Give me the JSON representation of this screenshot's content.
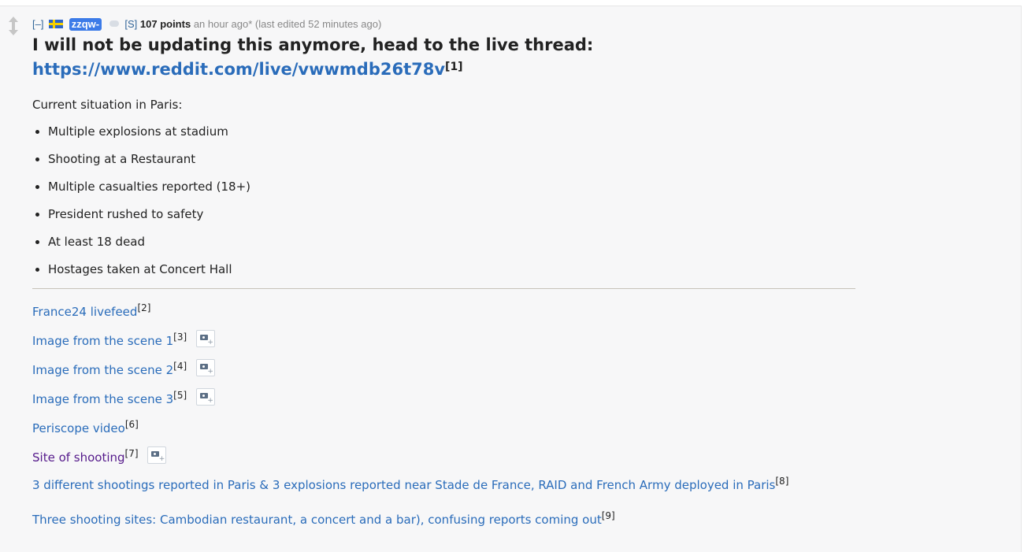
{
  "comment": {
    "expand_toggle": "[–]",
    "author": "zzqw-",
    "submitter_tag": "[S]",
    "score": "107 points",
    "time": "an hour ago*",
    "edited": "(last edited 52 minutes ago)",
    "headline": "I will not be updating this anymore, head to the live thread:",
    "live_link": "https://www.reddit.com/live/vwwmdb26t78v",
    "live_link_ref": "[1]",
    "intro": "Current situation in Paris:",
    "bullets": [
      "Multiple explosions at stadium",
      "Shooting at a Restaurant",
      "Multiple casualties reported (18+)",
      "President rushed to safety",
      "At least 18 dead",
      "Hostages taken at Concert Hall"
    ],
    "links": [
      {
        "text": "France24 livefeed",
        "ref": "[2]"
      },
      {
        "text": "Image from the scene 1",
        "ref": "[3]"
      },
      {
        "text": "Image from the scene 2",
        "ref": "[4]"
      },
      {
        "text": "Image from the scene 3",
        "ref": "[5]"
      },
      {
        "text": "Periscope video",
        "ref": "[6]"
      },
      {
        "text": "Site of shooting",
        "ref": "[7]"
      },
      {
        "text": "3 different shootings reported in Paris & 3 explosions reported near Stade de France, RAID and French Army deployed in Paris",
        "ref": "[8]"
      },
      {
        "text": "Three shooting sites: Cambodian restaurant, a concert and a bar), confusing reports coming out",
        "ref": "[9]"
      }
    ]
  },
  "icons": {
    "upvote": "arrow-up-icon",
    "downvote": "arrow-down-icon",
    "flair": "sweden-flag-icon",
    "gilded": "gilded-icon",
    "image_expando": "image-expando-icon"
  },
  "colors": {
    "link": "#2a6cba",
    "visited_link": "#551a8b",
    "author_badge": "#3c7be8",
    "background": "#f7f7f8"
  }
}
